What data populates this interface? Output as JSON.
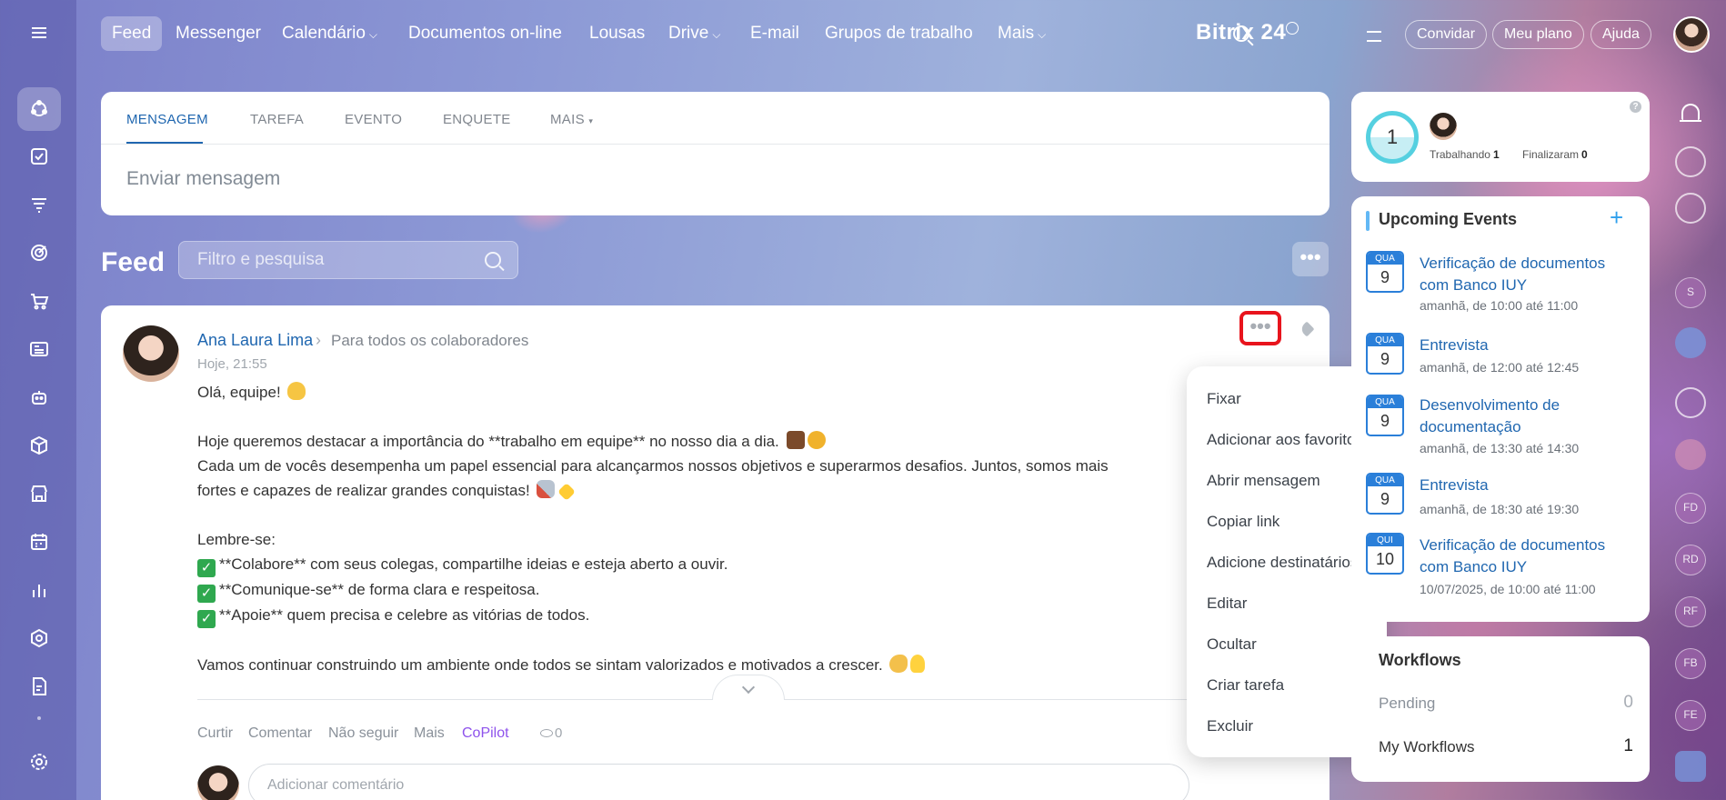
{
  "nav": {
    "items": [
      {
        "label": "Feed",
        "active": true,
        "has_chevron": false
      },
      {
        "label": "Messenger",
        "has_chevron": false
      },
      {
        "label": "Calendário",
        "has_chevron": true
      },
      {
        "label": "Documentos on-line",
        "has_chevron": false
      },
      {
        "label": "Lousas",
        "has_chevron": false
      },
      {
        "label": "Drive",
        "has_chevron": true
      },
      {
        "label": "E-mail",
        "has_chevron": false
      },
      {
        "label": "Grupos de trabalho",
        "has_chevron": false
      },
      {
        "label": "Mais",
        "has_chevron": true
      }
    ],
    "logo": "Bitrix 24",
    "invite_label": "Convidar",
    "plan_label": "Meu plano",
    "help_label": "Ajuda"
  },
  "left_rail": {
    "icons": [
      "menu-icon",
      "feed-icon",
      "tasks-icon",
      "crm-funnel-icon",
      "goals-icon",
      "cart-icon",
      "news-icon",
      "robot-icon",
      "box-icon",
      "store-icon",
      "calendar-grid-icon",
      "chart-icon",
      "hexagon-icon",
      "document-sign-icon",
      "settings-icon"
    ]
  },
  "composer": {
    "tabs": [
      "MENSAGEM",
      "TAREFA",
      "EVENTO",
      "ENQUETE",
      "MAIS"
    ],
    "placeholder": "Enviar mensagem"
  },
  "feed": {
    "title": "Feed",
    "filter_placeholder": "Filtro e pesquisa",
    "more": "•••"
  },
  "post": {
    "author": "Ana Laura Lima",
    "destination": "Para todos os colaboradores",
    "time": "Hoje, 21:55",
    "lines": [
      "Olá, equipe!",
      "",
      "Hoje queremos destacar a importância do **trabalho em equipe** no nosso dia a dia.",
      "Cada um de vocês desempenha um papel essencial para alcançarmos nossos objetivos e superarmos desafios. Juntos, somos mais",
      "fortes e capazes de realizar grandes conquistas!",
      "",
      "Lembre-se:",
      "**Colabore** com seus colegas, compartilhe ideias e esteja aberto a ouvir.",
      "**Comunique-se** de forma clara e respeitosa.",
      "**Apoie** quem precisa e celebre as vitórias de todos.",
      "",
      "Vamos continuar construindo um ambiente onde todos se sintam valorizados e motivados a crescer."
    ],
    "actions": [
      "Curtir",
      "Comentar",
      "Não seguir",
      "Mais",
      "CoPilot"
    ],
    "views": "0",
    "comment_placeholder": "Adicionar comentário",
    "dots": "•••"
  },
  "menu": {
    "items": [
      "Fixar",
      "Adicionar aos favoritos",
      "Abrir mensagem",
      "Copiar link",
      "Adicione destinatários",
      "Editar",
      "Ocultar",
      "Criar tarefa",
      "Excluir"
    ]
  },
  "status": {
    "count": "1",
    "working_label": "Trabalhando",
    "working_value": "1",
    "finished_label": "Finalizaram",
    "finished_value": "0",
    "help": "?"
  },
  "events": {
    "title": "Upcoming Events",
    "add": "+",
    "items": [
      {
        "day": "QUA",
        "date": "9",
        "title": "Verificação de documentos com Banco IUY",
        "time": "amanhã, de 10:00 até 11:00"
      },
      {
        "day": "QUA",
        "date": "9",
        "title": "Entrevista",
        "time": "amanhã, de 12:00 até 12:45"
      },
      {
        "day": "QUA",
        "date": "9",
        "title": "Desenvolvimento de documentação",
        "time": "amanhã, de 13:30 até 14:30"
      },
      {
        "day": "QUA",
        "date": "9",
        "title": "Entrevista",
        "time": "amanhã, de 18:30 até 19:30"
      },
      {
        "day": "QUI",
        "date": "10",
        "title": "Verificação de documentos com Banco IUY",
        "time": "10/07/2025, de 10:00 até 11:00"
      }
    ]
  },
  "workflows": {
    "title": "Workflows",
    "rows": [
      {
        "label": "Pending",
        "value": "0"
      },
      {
        "label": "My Workflows",
        "value": "1"
      }
    ]
  },
  "right_rail": {
    "initials": [
      "S",
      "FD",
      "RD",
      "RF",
      "FB",
      "FE"
    ]
  },
  "colors": {
    "accent": "#2067b0",
    "copilot": "#8e52ec",
    "highlight": "#e8141d"
  }
}
